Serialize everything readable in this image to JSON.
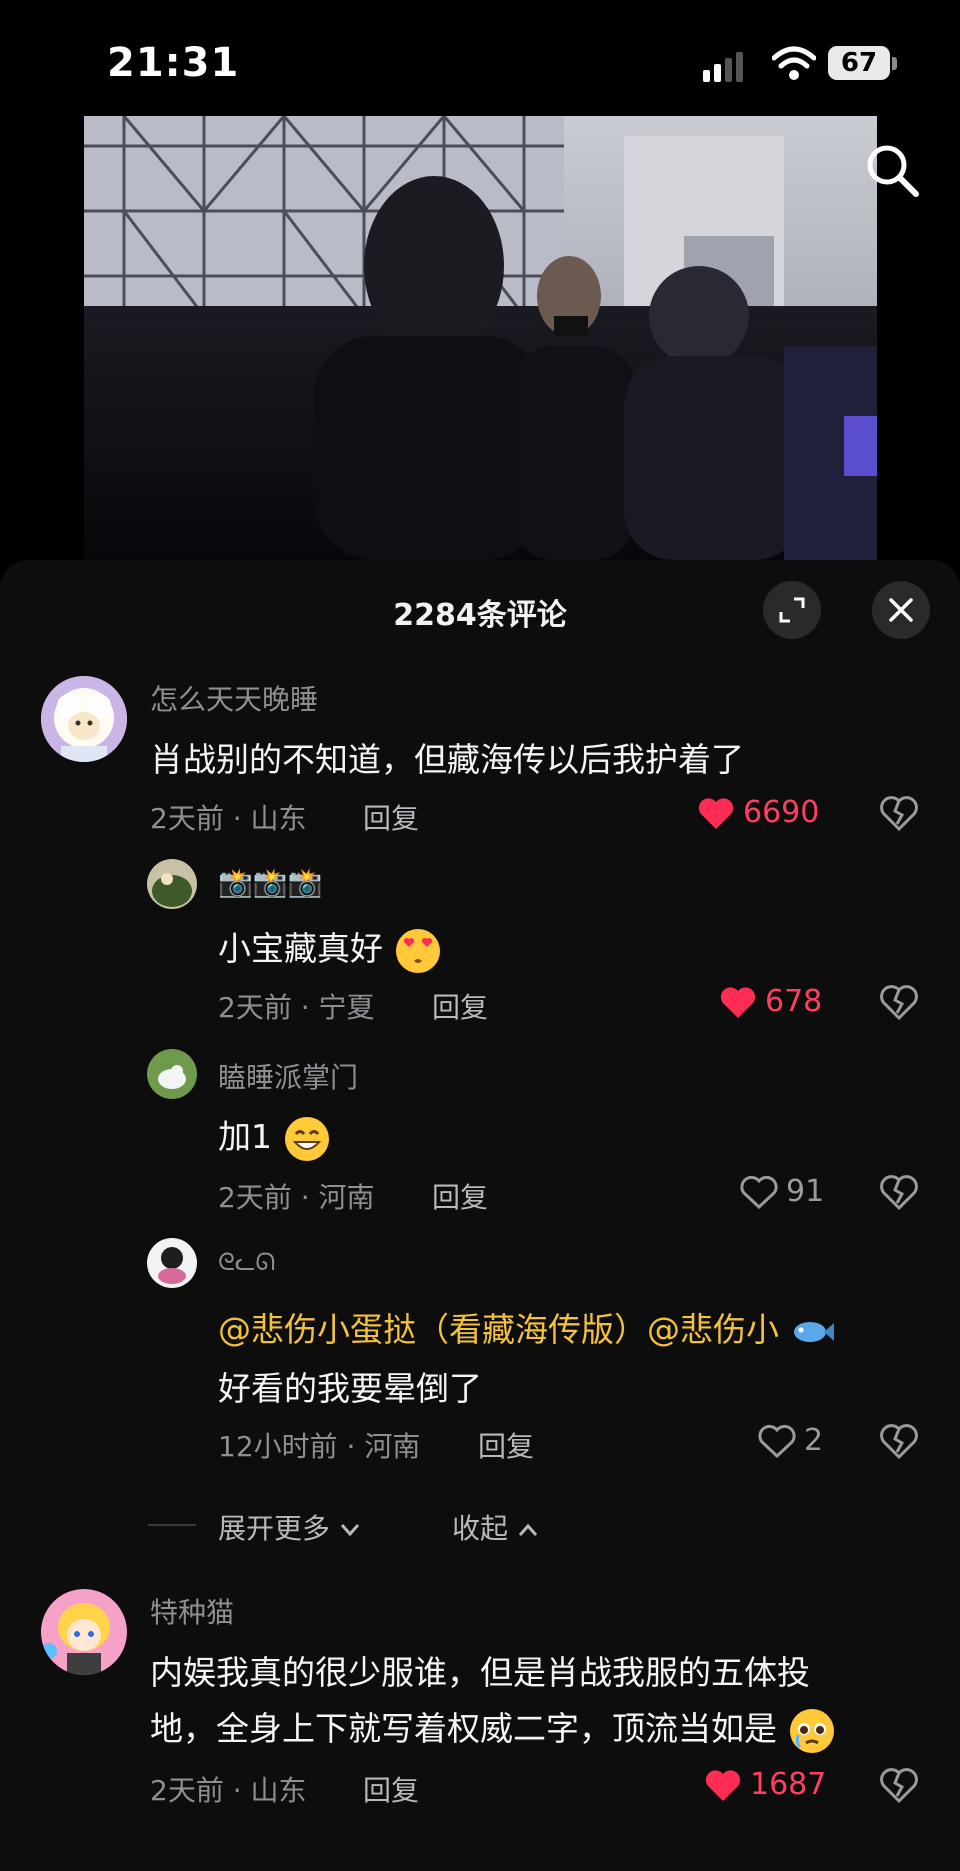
{
  "status": {
    "time": "21:31",
    "battery": "67"
  },
  "video": {
    "icons": [
      "search-icon"
    ]
  },
  "comments_header": {
    "title": "2284条评论"
  },
  "comments": [
    {
      "user": "怎么天天晚睡",
      "text": "肖战别的不知道，但藏海传以后我护着了",
      "meta": "2天前 · 山东",
      "reply": "回复",
      "likes": "6690",
      "liked": true
    },
    {
      "user": "📸📸📸",
      "text": "小宝藏真好",
      "meta": "2天前 · 宁夏",
      "reply": "回复",
      "likes": "678",
      "liked": true
    },
    {
      "user": "瞌睡派掌门",
      "text": "加1",
      "meta": "2天前 · 河南",
      "reply": "回复",
      "likes": "91",
      "liked": false
    },
    {
      "user": "ᘓᓚᘏ",
      "mention": "@悲伤小蛋挞（看藏海传版）@悲伤小",
      "text": "好看的我要晕倒了",
      "meta": "12小时前 · 河南",
      "reply": "回复",
      "likes": "2",
      "liked": false
    },
    {
      "user": "特种猫",
      "text_line1": "内娱我真的很少服谁，但是肖战我服的五体投",
      "text_line2": "地，全身上下就写着权威二字，顶流当如是",
      "meta": "2天前 · 山东",
      "reply": "回复",
      "likes": "1687",
      "liked": true
    }
  ],
  "thread_controls": {
    "expand": "展开更多",
    "collapse": "收起"
  },
  "colors": {
    "like_red": "#ff3f5f",
    "mention_yellow": "#f3c13a",
    "panel_bg": "#0d0d0e"
  }
}
